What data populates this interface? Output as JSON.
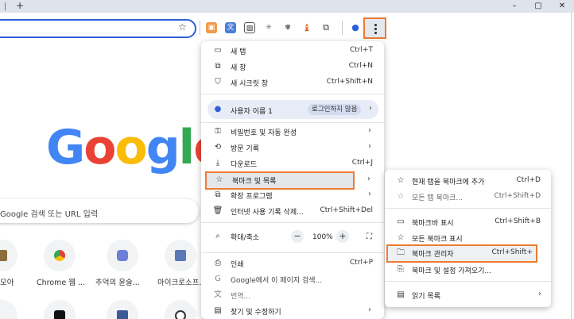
{
  "titlebar": {
    "minimize": "–",
    "restore": "▢",
    "close": "✕",
    "new_tab": "+"
  },
  "search": {
    "placeholder": "Google 검색 또는 URL 입력"
  },
  "logo": {
    "letters": [
      {
        "ch": "G",
        "color": "#4285f4"
      },
      {
        "ch": "o",
        "color": "#ea4335"
      },
      {
        "ch": "o",
        "color": "#fbbc05"
      },
      {
        "ch": "g",
        "color": "#4285f4"
      },
      {
        "ch": "l",
        "color": "#34a853"
      },
      {
        "ch": "e",
        "color": "#ea4335"
      }
    ]
  },
  "shortcuts": [
    {
      "label": "모아",
      "color": "#8a6d3b"
    },
    {
      "label": "Chrome 웹 ...",
      "color": "#db4437"
    },
    {
      "label": "추억의 윤술...",
      "color": "#6b7fd6"
    },
    {
      "label": "마이크로소프...",
      "color": "#5a77b8"
    }
  ],
  "menu": {
    "new_tab": {
      "label": "새 탭",
      "shortcut": "Ctrl+T"
    },
    "new_window": {
      "label": "새 창",
      "shortcut": "Ctrl+N"
    },
    "incognito": {
      "label": "새 시크릿 창",
      "shortcut": "Ctrl+Shift+N"
    },
    "profile": {
      "name": "사용자 이름 1",
      "badge": "로그인하지 않음"
    },
    "passwords": {
      "label": "비밀번호 및 자동 완성"
    },
    "history": {
      "label": "방문 기록"
    },
    "downloads": {
      "label": "다운로드",
      "shortcut": "Ctrl+J"
    },
    "bookmarks": {
      "label": "북마크 및 목록"
    },
    "extensions": {
      "label": "확장 프로그램"
    },
    "clear_data": {
      "label": "인터넷 사용 기록 삭제...",
      "shortcut": "Ctrl+Shift+Del"
    },
    "zoom": {
      "label": "확대/축소",
      "minus": "−",
      "value": "100%",
      "plus": "+"
    },
    "print": {
      "label": "인쇄",
      "shortcut": "Ctrl+P"
    },
    "search_page": {
      "label": "Google에서 이 페이지 검색..."
    },
    "translate": {
      "label": "번역..."
    },
    "find": {
      "label": "찾기 및 수정하기"
    }
  },
  "submenu": {
    "add_bookmark": {
      "label": "현재 탭을 북마크에 추가",
      "shortcut": "Ctrl+D"
    },
    "bookmark_all": {
      "label": "모든 탭 북마크...",
      "shortcut": "Ctrl+Shift+D"
    },
    "show_bar": {
      "label": "북마크바 표시",
      "shortcut": "Ctrl+Shift+B"
    },
    "show_all": {
      "label": "모든 북마크 표시"
    },
    "manager": {
      "label": "북마크 관리자",
      "shortcut": "Ctrl+Shift+"
    },
    "import": {
      "label": "북마크 및 설정 가져오기..."
    },
    "reading_list": {
      "label": "읽기 목록"
    }
  },
  "colors": {
    "accent_highlight": "#ee7b30",
    "omnibox_border": "#2d5fd6"
  }
}
